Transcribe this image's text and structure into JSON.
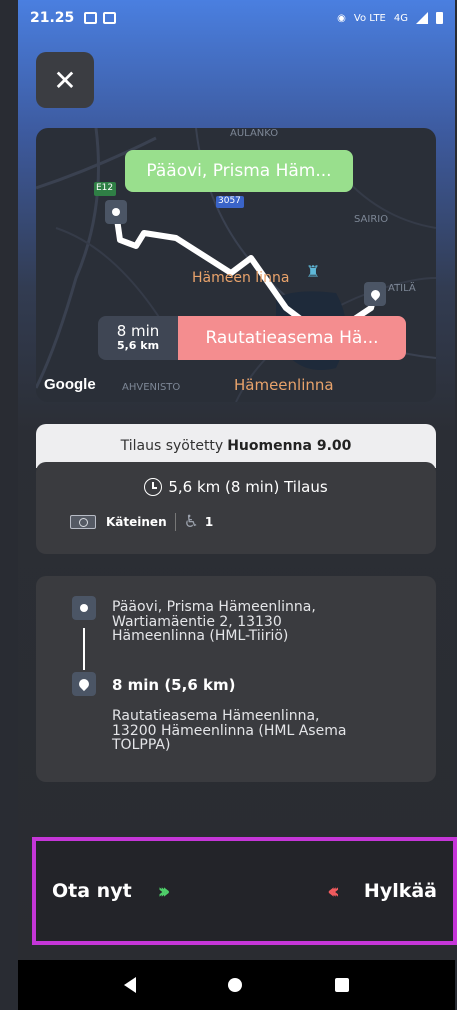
{
  "status_bar": {
    "time": "21.25",
    "network": "Vo LTE",
    "network_type": "4G"
  },
  "close": {
    "symbol": "✕"
  },
  "map": {
    "pickup_label": "Pääovi, Prisma Häm...",
    "dropoff_label": "Rautatieasema Hä...",
    "eta_minutes": "8 min",
    "eta_distance": "5,6 km",
    "places": {
      "aulanko": "AULANKO",
      "e12": "E12",
      "road_3057": "3057",
      "sairio": "SAIRIO",
      "hameen_linna": "Hämeen linna",
      "atila": "ATILÄ",
      "ahvenisto": "AHVENISTO",
      "hameenlinna": "Hämeenlinna"
    },
    "attribution": "Google"
  },
  "order": {
    "header_prefix": "Tilaus syötetty",
    "header_time": "Huomenna 9.00",
    "summary": "5,6 km (8 min) Tilaus",
    "payment": "Käteinen",
    "passengers": "1"
  },
  "route": {
    "pickup_address": [
      "Pääovi, Prisma Hämeenlinna,",
      "Wartiamäentie 2, 13130",
      "Hämeenlinna (HML-Tiiriö)"
    ],
    "duration": "8 min (5,6 km)",
    "dropoff_address": [
      "Rautatieasema Hämeenlinna,",
      "13200 Hämeenlinna (HML Asema",
      "TOLPPA)"
    ]
  },
  "actions": {
    "accept_label": "Ota nyt",
    "accept_chevrons": "›››",
    "reject_label": "Hylkää",
    "reject_chevrons": "‹‹‹"
  },
  "colors": {
    "pickup_bubble": "#99df8d",
    "dropoff_bubble": "#f48d8f",
    "highlight_border": "#c536d8",
    "accept_chevron": "#4fcf6a",
    "reject_chevron": "#f05b5e"
  }
}
